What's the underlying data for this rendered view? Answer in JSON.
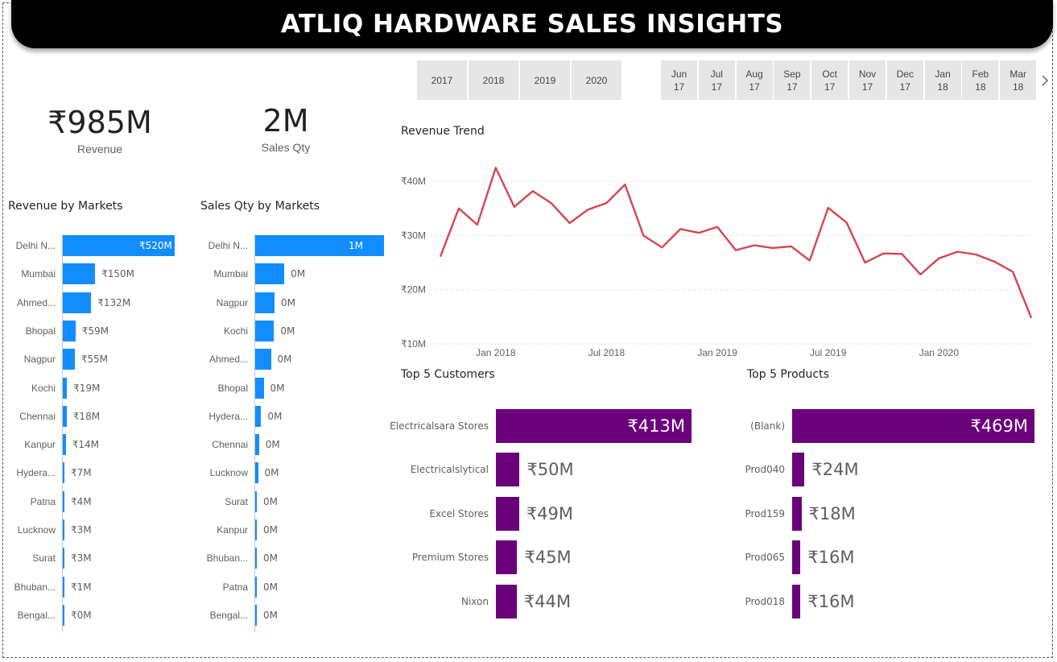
{
  "title": "ATLIQ HARDWARE SALES INSIGHTS",
  "kpis": {
    "revenue": {
      "value": "₹985M",
      "label": "Revenue"
    },
    "sales_qty": {
      "value": "2M",
      "label": "Sales Qty"
    }
  },
  "year_slicer": [
    "2017",
    "2018",
    "2019",
    "2020"
  ],
  "month_slicer": [
    {
      "m": "Jun",
      "y": "17"
    },
    {
      "m": "Jul",
      "y": "17"
    },
    {
      "m": "Aug",
      "y": "17"
    },
    {
      "m": "Sep",
      "y": "17"
    },
    {
      "m": "Oct",
      "y": "17"
    },
    {
      "m": "Nov",
      "y": "17"
    },
    {
      "m": "Dec",
      "y": "17"
    },
    {
      "m": "Jan",
      "y": "18"
    },
    {
      "m": "Feb",
      "y": "18"
    },
    {
      "m": "Mar",
      "y": "18"
    }
  ],
  "colors": {
    "market_bar": "#118dff",
    "top5_bar": "#6b007b",
    "trend_line": "#d64550"
  },
  "icons": {
    "next": "chevron-right-icon"
  },
  "chart_data": [
    {
      "type": "bar",
      "title": "Revenue by Markets",
      "categories": [
        "Delhi N...",
        "Mumbai",
        "Ahmed...",
        "Bhopal",
        "Nagpur",
        "Kochi",
        "Chennai",
        "Kanpur",
        "Hydera...",
        "Patna",
        "Lucknow",
        "Surat",
        "Bhuban...",
        "Bengal..."
      ],
      "values": [
        520,
        150,
        132,
        59,
        55,
        19,
        18,
        14,
        7,
        4,
        3,
        3,
        1,
        0
      ],
      "labels": [
        "₹520M",
        "₹150M",
        "₹132M",
        "₹59M",
        "₹55M",
        "₹19M",
        "₹18M",
        "₹14M",
        "₹7M",
        "₹4M",
        "₹3M",
        "₹3M",
        "₹1M",
        "₹0M"
      ]
    },
    {
      "type": "bar",
      "title": "Sales Qty by Markets",
      "categories": [
        "Delhi N...",
        "Mumbai",
        "Nagpur",
        "Kochi",
        "Ahmed...",
        "Bhopal",
        "Hydera...",
        "Chennai",
        "Lucknow",
        "Surat",
        "Kanpur",
        "Bhuban...",
        "Patna",
        "Bengal..."
      ],
      "values": [
        1000,
        226,
        150,
        146,
        122,
        66,
        46,
        30,
        22,
        12,
        10,
        8,
        6,
        4
      ],
      "labels": [
        "1M",
        "0M",
        "0M",
        "0M",
        "0M",
        "0M",
        "0M",
        "0M",
        "0M",
        "0M",
        "0M",
        "0M",
        "0M",
        "0M"
      ]
    },
    {
      "type": "line",
      "title": "Revenue Trend",
      "x": [
        "2017-10",
        "2017-11",
        "2017-12",
        "2018-01",
        "2018-02",
        "2018-03",
        "2018-04",
        "2018-05",
        "2018-06",
        "2018-07",
        "2018-08",
        "2018-09",
        "2018-10",
        "2018-11",
        "2018-12",
        "2019-01",
        "2019-02",
        "2019-03",
        "2019-04",
        "2019-05",
        "2019-06",
        "2019-07",
        "2019-08",
        "2019-09",
        "2019-10",
        "2019-11",
        "2019-12",
        "2020-01",
        "2020-02",
        "2020-03",
        "2020-04",
        "2020-05",
        "2020-06"
      ],
      "values": [
        26.1,
        35.0,
        32.0,
        42.5,
        35.3,
        38.2,
        36.0,
        32.3,
        34.8,
        36.0,
        39.4,
        30.0,
        27.8,
        31.2,
        30.5,
        31.6,
        27.3,
        28.2,
        27.7,
        28.0,
        25.4,
        35.1,
        32.4,
        25.0,
        26.7,
        26.6,
        22.8,
        25.8,
        27.0,
        26.5,
        25.2,
        23.3,
        14.8
      ],
      "x_ticks": [
        "Jan 2018",
        "Jul 2018",
        "Jan 2019",
        "Jul 2019",
        "Jan 2020"
      ],
      "y_ticks": [
        "₹10M",
        "₹20M",
        "₹30M",
        "₹40M"
      ],
      "ylim": [
        10,
        43
      ],
      "grid": true
    },
    {
      "type": "bar",
      "title": "Top 5 Customers",
      "categories": [
        "Electricalsara Stores",
        "Electricalslytical",
        "Excel Stores",
        "Premium Stores",
        "Nixon"
      ],
      "values": [
        413,
        50,
        49,
        45,
        44
      ],
      "labels": [
        "₹413M",
        "₹50M",
        "₹49M",
        "₹45M",
        "₹44M"
      ]
    },
    {
      "type": "bar",
      "title": "Top 5 Products",
      "categories": [
        "(Blank)",
        "Prod040",
        "Prod159",
        "Prod065",
        "Prod018"
      ],
      "values": [
        469,
        24,
        18,
        16,
        16
      ],
      "labels": [
        "₹469M",
        "₹24M",
        "₹18M",
        "₹16M",
        "₹16M"
      ]
    }
  ]
}
